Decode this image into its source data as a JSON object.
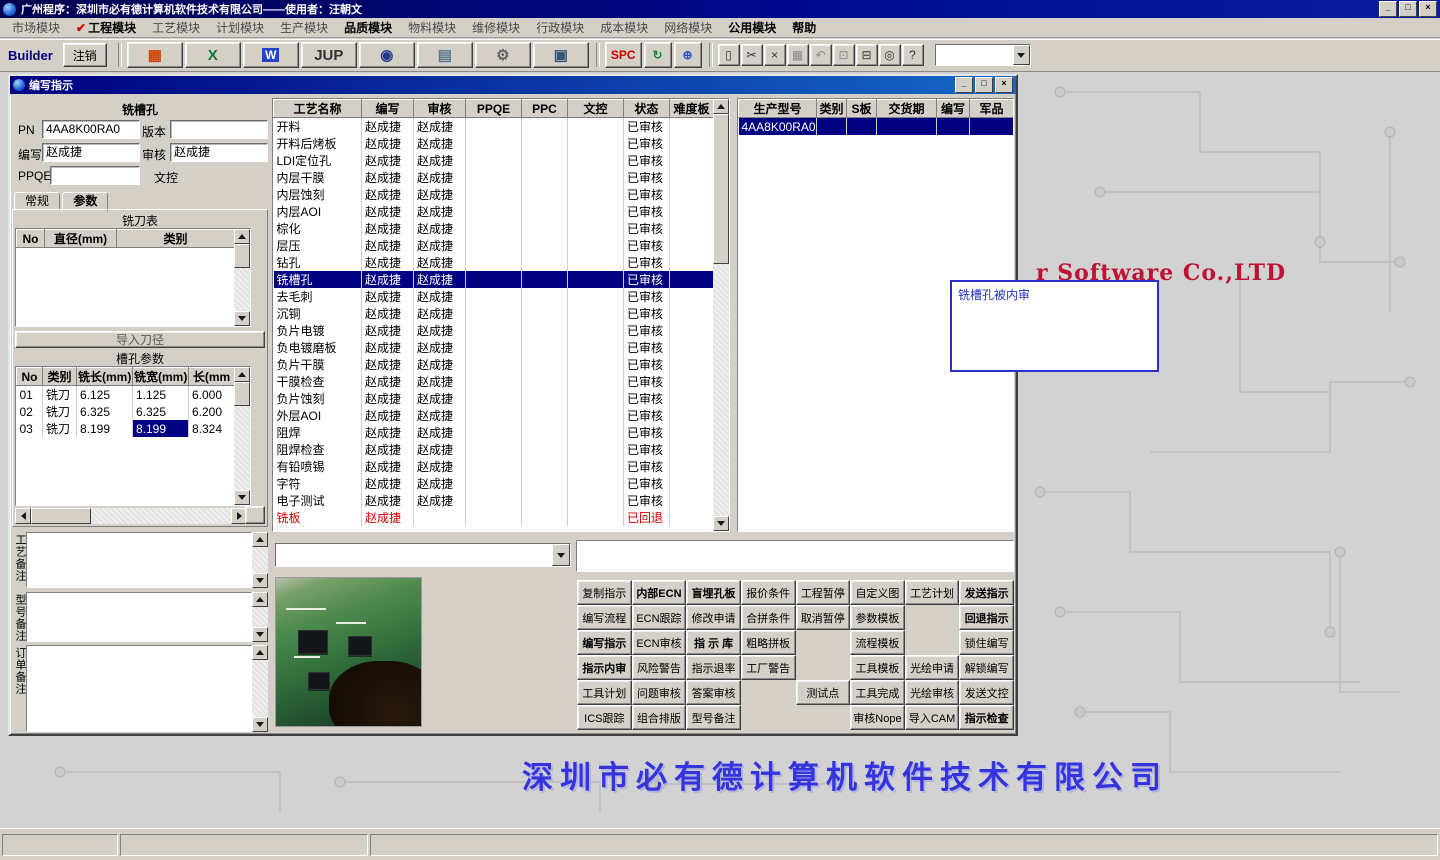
{
  "window": {
    "title": "广州程序：深圳市必有德计算机软件技术有限公司——使用者：汪朝文",
    "controls": {
      "minimize": "_",
      "restore": "□",
      "close": "×"
    }
  },
  "menu": {
    "items": [
      {
        "label": "市场模块"
      },
      {
        "label": "工程模块",
        "checked": true,
        "bold": true
      },
      {
        "label": "工艺模块"
      },
      {
        "label": "计划模块"
      },
      {
        "label": "生产模块"
      },
      {
        "label": "品质模块",
        "bold": true
      },
      {
        "label": "物料模块"
      },
      {
        "label": "维修模块"
      },
      {
        "label": "行政模块"
      },
      {
        "label": "成本模块"
      },
      {
        "label": "网络模块"
      },
      {
        "label": "公用模块",
        "bold": true
      },
      {
        "label": "帮助",
        "bold": true
      }
    ]
  },
  "toolbar": {
    "builder_label": "Builder",
    "logout_label": "注销",
    "big_buttons": [
      {
        "name": "form-grid-icon",
        "glyph": "▦",
        "color": "#cc4400"
      },
      {
        "name": "excel-icon",
        "glyph": "X",
        "color": "#0a7a2a"
      },
      {
        "name": "word-icon",
        "glyph": "W",
        "color": "#ffffff",
        "bg": "#2244cc"
      },
      {
        "name": "jup-button",
        "glyph": "JUP",
        "color": "#333333"
      },
      {
        "name": "preview-eye-icon",
        "glyph": "◉",
        "color": "#223a8c"
      },
      {
        "name": "database-icon",
        "glyph": "▤",
        "color": "#557788"
      },
      {
        "name": "machines-icon",
        "glyph": "⚙",
        "color": "#666666"
      },
      {
        "name": "computer-icon",
        "glyph": "▣",
        "color": "#335577"
      }
    ],
    "mid_buttons": [
      {
        "name": "spc-button",
        "glyph": "SPC",
        "color": "#cc0000"
      },
      {
        "name": "refresh-icon",
        "glyph": "↻",
        "color": "#11883a"
      },
      {
        "name": "globe-icon",
        "glyph": "⊕",
        "color": "#2255cc"
      }
    ],
    "small_buttons": [
      {
        "name": "new-doc-icon",
        "glyph": "▯",
        "color": "#333333"
      },
      {
        "name": "cut-icon",
        "glyph": "✂",
        "color": "#333333"
      },
      {
        "name": "delete-icon",
        "glyph": "×",
        "color": "#333333"
      },
      {
        "name": "save-icon",
        "glyph": "▦",
        "color": "#8a8a8a",
        "disabled": true
      },
      {
        "name": "undo-icon",
        "glyph": "↶",
        "color": "#8a8a8a",
        "disabled": true
      },
      {
        "name": "copy-icon",
        "glyph": "⊡",
        "color": "#8a8a8a",
        "disabled": true
      },
      {
        "name": "print-icon",
        "glyph": "⊟",
        "color": "#333333"
      },
      {
        "name": "find-icon",
        "glyph": "◎",
        "color": "#333333"
      },
      {
        "name": "help-icon",
        "glyph": "?",
        "color": "#333333"
      }
    ],
    "combo_value": ""
  },
  "child": {
    "title": "编写指示",
    "left_panel": {
      "title": "铣槽孔",
      "pn_label": "PN",
      "pn_value": "4AA8K00RA0",
      "version_label": "版本",
      "version_value": "",
      "writer_label": "编写",
      "writer_value": "赵成捷",
      "audit_label": "审核",
      "audit_value": "赵成捷",
      "ppqe_label": "PPQE",
      "ppqe_value": "",
      "doc_label": "文控",
      "doc_value": "",
      "tabs": [
        "常规",
        "参数"
      ],
      "cutter_table": {
        "title": "铣刀表",
        "headers": [
          "No",
          "直径(mm)",
          "类别"
        ],
        "rows": []
      },
      "import_button": "导入刀径",
      "slot_table": {
        "title": "槽孔参数",
        "headers": [
          "No",
          "类别",
          "铣长(mm)",
          "铣宽(mm)",
          "长(mm"
        ],
        "rows": [
          [
            "01",
            "铣刀",
            "6.125",
            "1.125",
            "6.000"
          ],
          [
            "02",
            "铣刀",
            "6.325",
            "6.325",
            "6.200"
          ],
          [
            "03",
            "铣刀",
            "8.199",
            "8.199",
            "8.324"
          ]
        ],
        "selected": {
          "row": 2,
          "col": 3
        }
      },
      "remarks": [
        {
          "label": "工艺备注",
          "value": ""
        },
        {
          "label": "型号备注",
          "value": ""
        },
        {
          "label": "订单备注",
          "value": ""
        }
      ]
    },
    "process_table": {
      "headers": [
        "工艺名称",
        "编写",
        "审核",
        "PPQE",
        "PPC",
        "文控",
        "状态",
        "难度板"
      ],
      "selected_index": 9,
      "rows": [
        {
          "name": "开料",
          "writer": "赵成捷",
          "auditor": "赵成捷",
          "status": "已审核"
        },
        {
          "name": "开料后烤板",
          "writer": "赵成捷",
          "auditor": "赵成捷",
          "status": "已审核"
        },
        {
          "name": "LDI定位孔",
          "writer": "赵成捷",
          "auditor": "赵成捷",
          "status": "已审核"
        },
        {
          "name": "内层干膜",
          "writer": "赵成捷",
          "auditor": "赵成捷",
          "status": "已审核"
        },
        {
          "name": "内层蚀刻",
          "writer": "赵成捷",
          "auditor": "赵成捷",
          "status": "已审核"
        },
        {
          "name": "内层AOI",
          "writer": "赵成捷",
          "auditor": "赵成捷",
          "status": "已审核"
        },
        {
          "name": "棕化",
          "writer": "赵成捷",
          "auditor": "赵成捷",
          "status": "已审核"
        },
        {
          "name": "层压",
          "writer": "赵成捷",
          "auditor": "赵成捷",
          "status": "已审核"
        },
        {
          "name": "钻孔",
          "writer": "赵成捷",
          "auditor": "赵成捷",
          "status": "已审核"
        },
        {
          "name": "铣槽孔",
          "writer": "赵成捷",
          "auditor": "赵成捷",
          "status": "已审核"
        },
        {
          "name": "去毛刺",
          "writer": "赵成捷",
          "auditor": "赵成捷",
          "status": "已审核"
        },
        {
          "name": "沉铜",
          "writer": "赵成捷",
          "auditor": "赵成捷",
          "status": "已审核"
        },
        {
          "name": "负片电镀",
          "writer": "赵成捷",
          "auditor": "赵成捷",
          "status": "已审核"
        },
        {
          "name": "负电镀磨板",
          "writer": "赵成捷",
          "auditor": "赵成捷",
          "status": "已审核"
        },
        {
          "name": "负片干膜",
          "writer": "赵成捷",
          "auditor": "赵成捷",
          "status": "已审核"
        },
        {
          "name": "干膜检查",
          "writer": "赵成捷",
          "auditor": "赵成捷",
          "status": "已审核"
        },
        {
          "name": "负片蚀刻",
          "writer": "赵成捷",
          "auditor": "赵成捷",
          "status": "已审核"
        },
        {
          "name": "外层AOI",
          "writer": "赵成捷",
          "auditor": "赵成捷",
          "status": "已审核"
        },
        {
          "name": "阻焊",
          "writer": "赵成捷",
          "auditor": "赵成捷",
          "status": "已审核"
        },
        {
          "name": "阻焊检查",
          "writer": "赵成捷",
          "auditor": "赵成捷",
          "status": "已审核"
        },
        {
          "name": "有铅喷锡",
          "writer": "赵成捷",
          "auditor": "赵成捷",
          "status": "已审核"
        },
        {
          "name": "字符",
          "writer": "赵成捷",
          "auditor": "赵成捷",
          "status": "已审核"
        },
        {
          "name": "电子测试",
          "writer": "赵成捷",
          "auditor": "赵成捷",
          "status": "已审核"
        },
        {
          "name": "铣板",
          "writer": "赵成捷",
          "auditor": "",
          "status": "已回退",
          "returned": true
        }
      ]
    },
    "model_table": {
      "headers": [
        "生产型号",
        "类别",
        "S板",
        "交货期",
        "编写",
        "军品"
      ],
      "rows": [
        {
          "cells": [
            "4AA8K00RA0",
            "",
            "",
            "",
            "",
            ""
          ],
          "selected": true
        }
      ]
    },
    "bottom": {
      "combo_value": "",
      "info_value": "",
      "actions": [
        [
          {
            "label": "复制指示"
          },
          {
            "label": "内部ECN",
            "bold": true
          },
          {
            "label": "盲埋孔板",
            "bold": true
          },
          {
            "label": "报价条件"
          },
          {
            "label": "工程暂停"
          },
          {
            "label": "自定义图"
          },
          {
            "label": "工艺计划"
          },
          {
            "label": "发送指示",
            "bold": true
          }
        ],
        [
          {
            "label": "编写流程"
          },
          {
            "label": "ECN跟踪"
          },
          {
            "label": "修改申请"
          },
          {
            "label": "合拼条件"
          },
          {
            "label": "取消暂停"
          },
          {
            "label": "参数模板"
          },
          null,
          {
            "label": "回退指示",
            "bold": true
          }
        ],
        [
          {
            "label": "编写指示",
            "bold": true
          },
          {
            "label": "ECN审核"
          },
          {
            "label": "指 示 库",
            "bold": true
          },
          {
            "label": "粗略拼板"
          },
          null,
          {
            "label": "流程模板"
          },
          null,
          {
            "label": "锁住编写"
          }
        ],
        [
          {
            "label": "指示内审",
            "bold": true
          },
          {
            "label": "风险警告"
          },
          {
            "label": "指示退率"
          },
          {
            "label": "工厂警告"
          },
          null,
          {
            "label": "工具模板"
          },
          {
            "label": "光绘申请"
          },
          {
            "label": "解锁编写"
          }
        ],
        [
          {
            "label": "工具计划"
          },
          {
            "label": "问题审核"
          },
          {
            "label": "答案审核"
          },
          null,
          {
            "label": "测试点"
          },
          {
            "label": "工具完成"
          },
          {
            "label": "光绘审核"
          },
          {
            "label": "发送文控"
          }
        ],
        [
          {
            "label": "ICS跟踪"
          },
          {
            "label": "组合排版"
          },
          {
            "label": "型号备注"
          },
          null,
          null,
          {
            "label": "审核Nope"
          },
          {
            "label": "导入CAM"
          },
          {
            "label": "指示检查",
            "bold": true
          }
        ]
      ]
    }
  },
  "overlay": {
    "tooltip": "铣槽孔被内审",
    "bg_red_text": "r Software Co.,LTD",
    "company_text": "深圳市必有德计算机软件技术有限公司"
  },
  "colors": {
    "selection": "#000080",
    "returned_text": "#d00000",
    "tooltip_border": "#2830c8",
    "titlebar": "#000080"
  }
}
